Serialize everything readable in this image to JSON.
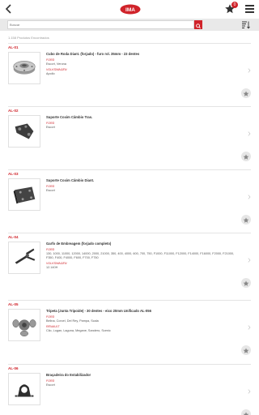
{
  "header": {
    "logo_text": "IMA",
    "favorites_badge": "0"
  },
  "search": {
    "placeholder": "Buscar"
  },
  "results": {
    "count_text": "1.158 Produtos Encontrados"
  },
  "products": [
    {
      "code": "AL-01",
      "title": "Cubo de Roda Diant. (forjado) - furo rol. 35mm - 23 dentes",
      "groups": [
        {
          "brand": "FORD",
          "apps": "Escort, Verona"
        },
        {
          "brand": "VOLKSWAGEN",
          "apps": "Apollo"
        }
      ],
      "icon": "wheel-hub"
    },
    {
      "code": "AL-02",
      "title": "Suporte Coxim Câmbio Tras.",
      "groups": [
        {
          "brand": "FORD",
          "apps": "Escort"
        }
      ],
      "icon": "mount-bracket"
    },
    {
      "code": "AL-03",
      "title": "Suporte Coxim Câmbio Diant.",
      "groups": [
        {
          "brand": "FORD",
          "apps": "Escort"
        }
      ],
      "icon": "support-plate"
    },
    {
      "code": "AL-04",
      "title": "Garfo de Embreagem (forjado completo)",
      "groups": [
        {
          "brand": "FORD",
          "apps": "130, 1000, 11000, 12000, 14000, 2000, 21000, 350, 400, 4000, 600, 700, 750, F1000, F11000, F12000, F14000, F16000, F2000, F21000, F350, F400, F4000, F600, F700, F750"
        },
        {
          "brand": "VOLKSWAGEN",
          "apps": "12.140H"
        }
      ],
      "icon": "clutch-fork"
    },
    {
      "code": "AL-05",
      "title": "Tripeta (Junta Tripoide) - 30 dentes - eixo 20mm Unificado AL-056",
      "groups": [
        {
          "brand": "FORD",
          "apps": "Belina, Corcel, Del Rey, Pampa, Scala"
        },
        {
          "brand": "RENAULT",
          "apps": "Clio, Logan, Laguna, Megane, Sandero, Scenic"
        }
      ],
      "icon": "tripod-joint"
    },
    {
      "code": "AL-06",
      "title": "Braçadeira do Estabilizador",
      "groups": [
        {
          "brand": "FORD",
          "apps": "Escort"
        }
      ],
      "icon": "stabilizer-clamp"
    }
  ],
  "colors": {
    "accent": "#d0232a",
    "search_bg": "#e9e9e9"
  }
}
